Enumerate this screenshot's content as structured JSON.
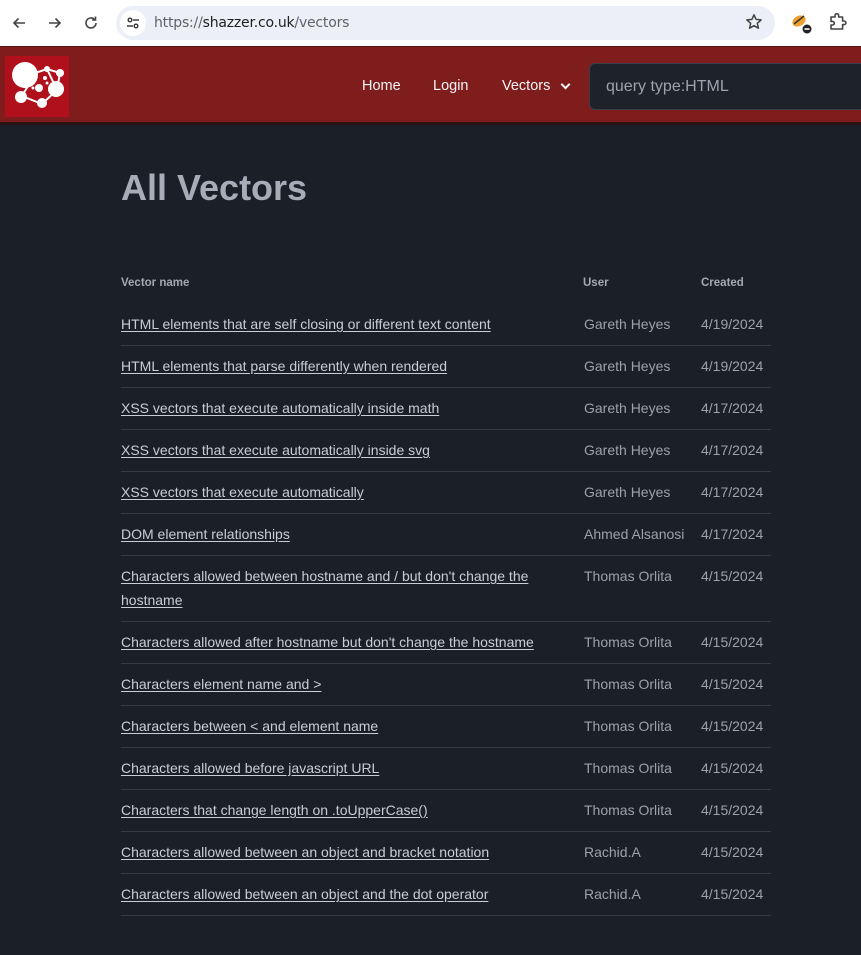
{
  "browser": {
    "url_scheme": "https://",
    "url_host": "shazzer.co.uk",
    "url_path": "/vectors",
    "icons": {
      "back": "arrow-left-icon",
      "forward": "arrow-right-icon",
      "reload": "reload-icon",
      "site_info": "tune-icon",
      "bookmark": "star-icon",
      "extension": "extension-blocked-icon",
      "extensions_menu": "puzzle-icon"
    }
  },
  "header": {
    "logo": "shazzer-molecule-logo",
    "nav": {
      "home": "Home",
      "login": "Login",
      "vectors": "Vectors"
    },
    "search_placeholder": "query type:HTML",
    "colors": {
      "header_bg": "#7f1d1d",
      "logo_bg": "#b0101c",
      "page_bg": "#1b1f27"
    }
  },
  "main": {
    "title": "All Vectors",
    "table": {
      "columns": [
        "Vector name",
        "User",
        "Created"
      ],
      "rows": [
        {
          "name": "HTML elements that are self closing or different text content",
          "user": "Gareth Heyes",
          "created": "4/19/2024"
        },
        {
          "name": "HTML elements that parse differently when rendered",
          "user": "Gareth Heyes",
          "created": "4/19/2024"
        },
        {
          "name": "XSS vectors that execute automatically inside math",
          "user": "Gareth Heyes",
          "created": "4/17/2024"
        },
        {
          "name": "XSS vectors that execute automatically inside svg",
          "user": "Gareth Heyes",
          "created": "4/17/2024"
        },
        {
          "name": "XSS vectors that execute automatically",
          "user": "Gareth Heyes",
          "created": "4/17/2024"
        },
        {
          "name": "DOM element relationships",
          "user": "Ahmed Alsanosi",
          "created": "4/17/2024"
        },
        {
          "name": "Characters allowed between hostname and / but don't change the hostname",
          "user": "Thomas Orlita",
          "created": "4/15/2024"
        },
        {
          "name": "Characters allowed after hostname but don't change the hostname",
          "user": "Thomas Orlita",
          "created": "4/15/2024"
        },
        {
          "name": "Characters element name and >",
          "user": "Thomas Orlita",
          "created": "4/15/2024"
        },
        {
          "name": "Characters between < and element name",
          "user": "Thomas Orlita",
          "created": "4/15/2024"
        },
        {
          "name": "Characters allowed before javascript URL",
          "user": "Thomas Orlita",
          "created": "4/15/2024"
        },
        {
          "name": "Characters that change length on .toUpperCase()",
          "user": "Thomas Orlita",
          "created": "4/15/2024"
        },
        {
          "name": "Characters allowed between an object and bracket notation",
          "user": "Rachid.A",
          "created": "4/15/2024"
        },
        {
          "name": "Characters allowed between an object and the dot operator",
          "user": "Rachid.A",
          "created": "4/15/2024"
        }
      ]
    }
  }
}
